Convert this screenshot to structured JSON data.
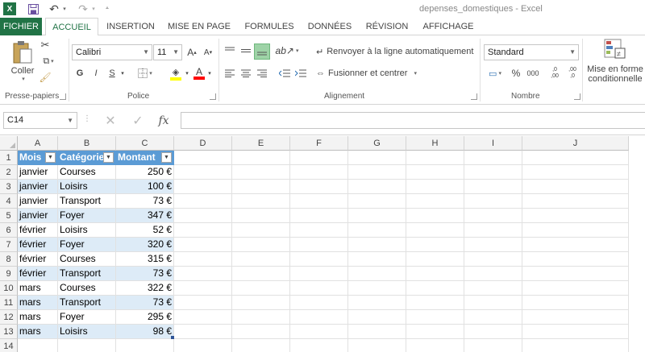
{
  "window": {
    "title": "depenses_domestiques - Excel",
    "excel_logo": "X",
    "quick_access": [
      "save-icon",
      "undo-icon",
      "redo-icon",
      "customize-icon"
    ]
  },
  "tabs": [
    {
      "label": "FICHIER"
    },
    {
      "label": "ACCUEIL"
    },
    {
      "label": "INSERTION"
    },
    {
      "label": "MISE EN PAGE"
    },
    {
      "label": "FORMULES"
    },
    {
      "label": "DONNÉES"
    },
    {
      "label": "RÉVISION"
    },
    {
      "label": "AFFICHAGE"
    }
  ],
  "ribbon": {
    "clipboard": {
      "paste_label": "Coller",
      "group_label": "Presse-papiers"
    },
    "font": {
      "font_name": "Calibri",
      "font_size": "11",
      "bold": "G",
      "italic": "I",
      "underline": "S",
      "group_label": "Police",
      "fill_color": "#ffff00",
      "font_color": "#ff0000"
    },
    "alignment": {
      "wrap_label": "Renvoyer à la ligne automatiquement",
      "merge_label": "Fusionner et centrer",
      "group_label": "Alignement"
    },
    "number": {
      "format": "Standard",
      "percent": "%",
      "thousands": "000",
      "inc_decimals": ",0\n,00",
      "dec_decimals": ",00\n,0",
      "group_label": "Nombre"
    },
    "styles": {
      "cond_format_line1": "Mise en forme",
      "cond_format_line2": "conditionnelle"
    }
  },
  "formula_bar": {
    "name_box": "C14",
    "formula": ""
  },
  "sheet": {
    "columns": [
      "A",
      "B",
      "C",
      "D",
      "E",
      "F",
      "G",
      "H",
      "I",
      "J"
    ],
    "row_numbers": [
      "1",
      "2",
      "3",
      "4",
      "5",
      "6",
      "7",
      "8",
      "9",
      "10",
      "11",
      "12",
      "13",
      "14"
    ],
    "table_headers": [
      "Mois",
      "Catégorie",
      "Montant"
    ],
    "rows": [
      [
        "janvier",
        "Courses",
        "250 €"
      ],
      [
        "janvier",
        "Loisirs",
        "100 €"
      ],
      [
        "janvier",
        "Transport",
        "73 €"
      ],
      [
        "janvier",
        "Foyer",
        "347 €"
      ],
      [
        "février",
        "Loisirs",
        "52 €"
      ],
      [
        "février",
        "Foyer",
        "320 €"
      ],
      [
        "février",
        "Courses",
        "315 €"
      ],
      [
        "février",
        "Transport",
        "73 €"
      ],
      [
        "mars",
        "Courses",
        "322 €"
      ],
      [
        "mars",
        "Transport",
        "73 €"
      ],
      [
        "mars",
        "Foyer",
        "295 €"
      ],
      [
        "mars",
        "Loisirs",
        "98 €"
      ]
    ],
    "table_header_color": "#5b9bd5",
    "band_color": "#ddebf7"
  }
}
